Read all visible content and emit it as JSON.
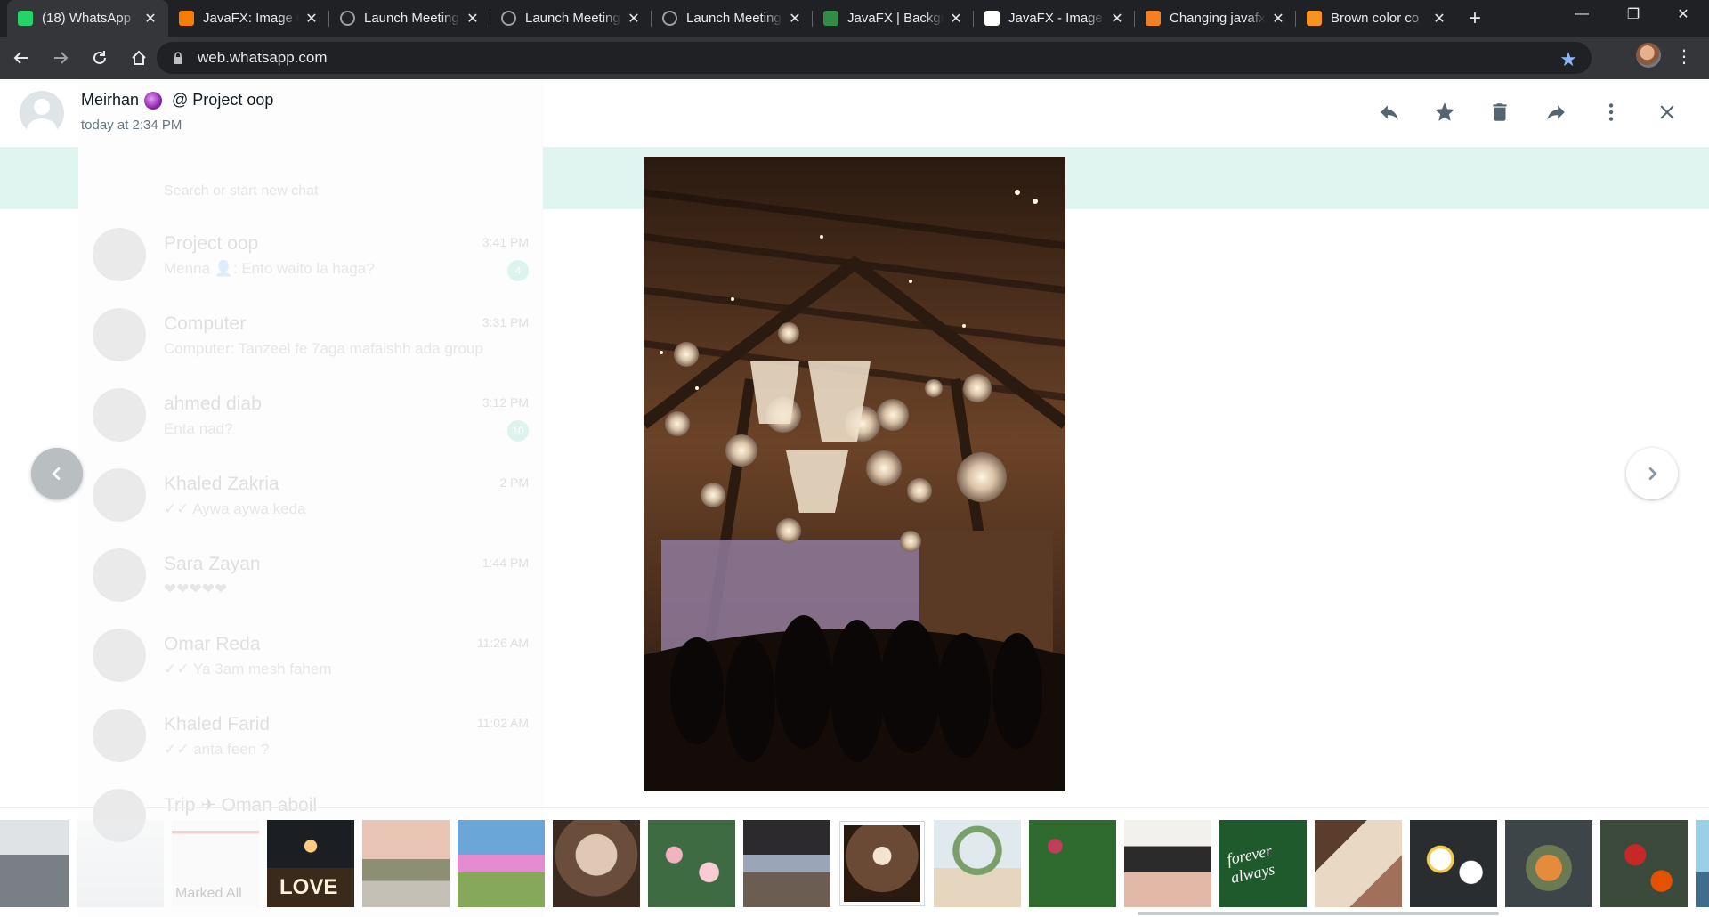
{
  "browser": {
    "tabs": [
      {
        "label": "(18) WhatsApp",
        "favicon": "whatsapp-icon",
        "color": "#25d366",
        "active": true
      },
      {
        "label": "JavaFX: Image C",
        "favicon": "blogger-icon",
        "color": "#f57d00",
        "active": false
      },
      {
        "label": "Launch Meeting",
        "favicon": "globe-icon",
        "color": "#9aa0a6",
        "active": false
      },
      {
        "label": "Launch Meeting",
        "favicon": "globe-icon",
        "color": "#9aa0a6",
        "active": false
      },
      {
        "label": "Launch Meeting",
        "favicon": "globe-icon",
        "color": "#9aa0a6",
        "active": false
      },
      {
        "label": "JavaFX | Backgr",
        "favicon": "geeksforgeeks-icon",
        "color": "#2f8d46",
        "active": false
      },
      {
        "label": "JavaFX - Image",
        "favicon": "tutorialspoint-icon",
        "color": "#ffffff",
        "active": false
      },
      {
        "label": "Changing javafx",
        "favicon": "stackoverflow-icon",
        "color": "#f48024",
        "active": false
      },
      {
        "label": "Brown color co",
        "favicon": "r-icon",
        "color": "#f7941d",
        "active": false
      }
    ],
    "new_tab": "+",
    "url": "web.whatsapp.com",
    "bookmark_star_color": "#8ab4f8"
  },
  "viewer": {
    "sender": "Meirhan",
    "group": " @ Project oop",
    "timestamp": "today at 2:34 PM",
    "actions": [
      "reply-icon",
      "star-icon",
      "delete-icon",
      "forward-icon",
      "more-options-icon",
      "close-icon"
    ]
  },
  "background_chats": [
    {
      "name": "Project oop",
      "message": "Menna 👤: Ento waito la haga?",
      "time": "3:41 PM",
      "badge": "4"
    },
    {
      "name": "Computer",
      "message": "Computer: Tanzeel fe 7aga mafaishh ada group",
      "time": "3:31 PM",
      "badge": ""
    },
    {
      "name": "ahmed diab",
      "message": "Enta nad?",
      "time": "3:12 PM",
      "badge": "10"
    },
    {
      "name": "Khaled Zakria",
      "message": "✓✓ Aywa aywa keda",
      "time": "2 PM",
      "badge": ""
    },
    {
      "name": "Sara Zayan",
      "message": "❤❤❤❤❤",
      "time": "1:44 PM",
      "badge": ""
    },
    {
      "name": "Omar Reda",
      "message": "✓✓ Ya 3am mesh fahem",
      "time": "11:26 AM",
      "badge": ""
    },
    {
      "name": "Khaled Farid",
      "message": "✓✓ anta feen ?",
      "time": "11:02 AM",
      "badge": ""
    },
    {
      "name": "Trip ✈ Oman aboil",
      "message": "",
      "time": "",
      "badge": ""
    }
  ],
  "search_placeholder": "Search or start new chat",
  "thumbnails": [
    {
      "name": "thumb-people",
      "faded": false
    },
    {
      "name": "thumb-document-1",
      "faded": true
    },
    {
      "name": "thumb-document-2",
      "faded": true
    },
    {
      "name": "thumb-love-sign",
      "faded": false
    },
    {
      "name": "thumb-long-table",
      "faded": false
    },
    {
      "name": "thumb-floral-arch",
      "faded": false
    },
    {
      "name": "thumb-pampas-decor",
      "faded": false
    },
    {
      "name": "thumb-rose-wall",
      "faded": false
    },
    {
      "name": "thumb-reception-hall",
      "faded": false
    },
    {
      "name": "thumb-chandelier-barn",
      "faded": false,
      "selected": true
    },
    {
      "name": "thumb-beach-arch",
      "faded": false
    },
    {
      "name": "thumb-hedge-sign",
      "faded": false
    },
    {
      "name": "thumb-lantern",
      "faded": false
    },
    {
      "name": "thumb-forever-always",
      "faded": false
    },
    {
      "name": "thumb-invitation",
      "faded": false
    },
    {
      "name": "thumb-daisies",
      "faded": false
    },
    {
      "name": "thumb-bouquet",
      "faded": false
    },
    {
      "name": "thumb-red-flowers",
      "faded": false
    },
    {
      "name": "thumb-palm-sky",
      "faded": false
    }
  ],
  "thumbnail_text": {
    "love": "LOVE",
    "marked": "Marked All",
    "forever": "forever always"
  }
}
